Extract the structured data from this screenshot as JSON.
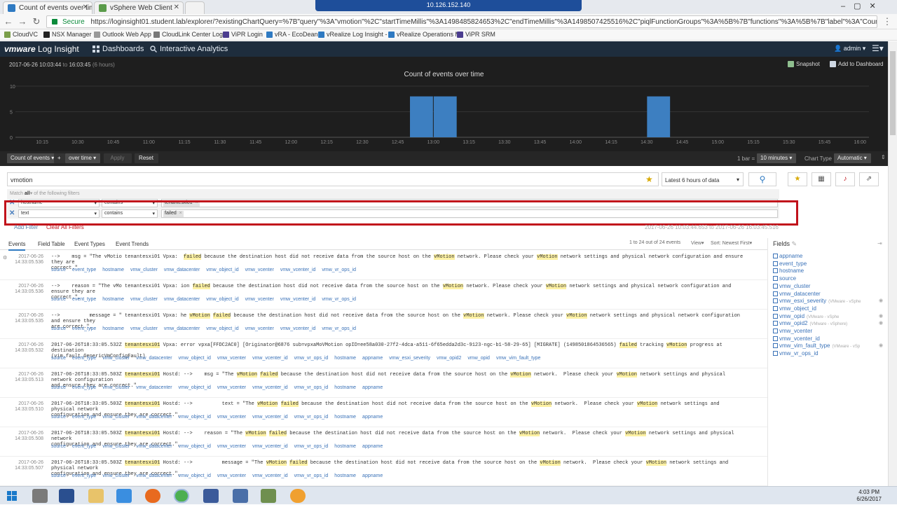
{
  "browser": {
    "tabs": [
      {
        "title": "Count of events over tim",
        "active": true
      },
      {
        "title": "vSphere Web Client",
        "active": false
      }
    ],
    "remote_title": "10.126.152.140",
    "secure_label": "Secure",
    "url": "https://loginsight01.student.lab/explorer/?existingChartQuery=%7B\"query\"%3A\"vmotion\"%2C\"startTimeMillis\"%3A1498485824653%2C\"endTimeMillis\"%3A1498507425516%2C\"piqlFunctionGroups\"%3A%5B%7B\"functions\"%3A%5B%7B\"label\"%3A\"Count\"%2C\"value\"%3A\"C",
    "bookmarks": [
      "CloudVC",
      "NSX Manager",
      "Outlook Web App",
      "CloudLink Center Log",
      "ViPR Login",
      "vRA - EcoDean",
      "vRealize Log Insight -",
      "vRealize Operations M",
      "ViPR SRM"
    ]
  },
  "app": {
    "logo_brand": "vmware",
    "logo_product": "Log Insight",
    "nav": [
      "Dashboards",
      "Interactive Analytics"
    ],
    "user": "admin"
  },
  "chart": {
    "time_start": "2017-06-26 10:03:44",
    "time_to": "to",
    "time_end": "16:03:45",
    "duration": "(6 hours)",
    "snapshot_label": "Snapshot",
    "add_dashboard_label": "Add to Dashboard"
  },
  "chart_data": {
    "type": "bar",
    "title": "Count of events over time",
    "x_ticks": [
      "10:15",
      "10:30",
      "10:45",
      "11:00",
      "11:15",
      "11:30",
      "11:45",
      "12:00",
      "12:15",
      "12:30",
      "12:45",
      "13:00",
      "13:15",
      "13:30",
      "13:45",
      "14:00",
      "14:15",
      "14:30",
      "14:45",
      "15:00",
      "15:15",
      "15:30",
      "15:45",
      "16:00"
    ],
    "y_ticks": [
      0,
      5,
      10
    ],
    "ylim": [
      0,
      10
    ],
    "bars": [
      {
        "start": "12:50",
        "end": "13:00",
        "value": 8
      },
      {
        "start": "13:00",
        "end": "13:10",
        "value": 8
      },
      {
        "start": "14:30",
        "end": "14:40",
        "value": 8
      }
    ],
    "grid": true
  },
  "controls": {
    "count_btn": "Count of events",
    "plus_btn": "+",
    "over_time_btn": "over time",
    "apply_btn": "Apply",
    "reset_btn": "Reset",
    "bar_label": "1 bar =",
    "bar_value": "10 minutes",
    "chart_type_label": "Chart Type",
    "chart_type_value": "Automatic"
  },
  "query": {
    "text": "vmotion",
    "range": "Latest 6 hours of data"
  },
  "filters": {
    "match_prefix": "Match",
    "match_value": "all",
    "match_suffix": "of the following filters",
    "rows": [
      {
        "field": "hostname",
        "op": "contains",
        "value": "tenantesxi01"
      },
      {
        "field": "text",
        "op": "contains",
        "value": "failed"
      }
    ],
    "add_filter": "Add Filter",
    "clear_filters": "Clear All Filters",
    "range_start": "2017-06-26 10:03:44.653",
    "range_to": "to",
    "range_end": "2017-06-26 16:03:45.516"
  },
  "events_tabs": [
    "Events",
    "Field Table",
    "Event Types",
    "Event Trends"
  ],
  "events_meta": {
    "count": "1 to 24 out of 24 events",
    "view": "View",
    "sort": "Sort: Newest First"
  },
  "events": [
    {
      "date": "2017-06-26",
      "time": "14:33:05.536",
      "text_parts": [
        "-->    msg = \"The vMotio tenantesxi01 Vpxa:  ",
        "failed",
        " because the destination host did not receive data from the source host on the ",
        "vMotion",
        " network. Please check your ",
        "vMotion",
        " network settings and physical network configuration and ensure they are\ncorrect.\""
      ],
      "fields": [
        "source",
        "event_type",
        "hostname",
        "vmw_cluster",
        "vmw_datacenter",
        "vmw_object_id",
        "vmw_vcenter",
        "vmw_vcenter_id",
        "vmw_vr_ops_id"
      ]
    },
    {
      "date": "2017-06-26",
      "time": "14:33:05.536",
      "text_parts": [
        "-->    reason = \"The vMo tenantesxi01 Vpxa: ion ",
        "failed",
        " because the destination host did not receive data from the source host on the ",
        "vMotion",
        " network. Please check your ",
        "vMotion",
        " network settings and physical network configuration and ensure they are\ncorrect.\","
      ],
      "fields": [
        "source",
        "event_type",
        "hostname",
        "vmw_cluster",
        "vmw_datacenter",
        "vmw_object_id",
        "vmw_vcenter",
        "vmw_vcenter_id",
        "vmw_vr_ops_id"
      ]
    },
    {
      "date": "2017-06-26",
      "time": "14:33:05.535",
      "text_parts": [
        "-->          message = \" tenantesxi01 Vpxa: he ",
        "vMotion",
        " ",
        "failed",
        " because the destination host did not receive data from the source host on the ",
        "vMotion",
        " network. Please check your ",
        "vMotion",
        " network settings and physical network configuration and ensure they\nare correct.\","
      ],
      "fields": [
        "source",
        "event_type",
        "hostname",
        "vmw_cluster",
        "vmw_datacenter",
        "vmw_object_id",
        "vmw_vcenter",
        "vmw_vcenter_id",
        "vmw_vr_ops_id"
      ]
    },
    {
      "date": "2017-06-26",
      "time": "14:33:05.532",
      "text_parts": [
        "2017-06-26T18:33:05.532Z ",
        "tenantesxi01",
        " Vpxa: error vpxa[FFDC2AC0] [Originator@6876 sub=vpxaMoVMotion opID=ee58a030-27f2-4dca-a511-6f65edda2d3c-9123-ngc-b1-58-29-65] [MIGRATE] (1498501864536565) ",
        "failed",
        " tracking ",
        "vMotion",
        " progress at destination\n(vim.fault.GenericVmConfigFault)"
      ],
      "fields": [
        "source",
        "event_type",
        "vmw_cluster",
        "vmw_datacenter",
        "vmw_object_id",
        "vmw_vcenter",
        "vmw_vcenter_id",
        "vmw_vr_ops_id",
        "hostname",
        "appname",
        "vmw_esxi_severity",
        "vmw_opid2",
        "vmw_opid",
        "vmw_vim_fault_type"
      ]
    },
    {
      "date": "2017-06-26",
      "time": "14:33:05.513",
      "text_parts": [
        "2017-06-26T18:33:05.503Z ",
        "tenantesxi01",
        " Hostd: -->    msg = \"The ",
        "vMotion",
        " ",
        "failed",
        " because the destination host did not receive data from the source host on the ",
        "vMotion",
        " network.  Please check your ",
        "vMotion",
        " network settings and physical network configuration\nand ensure they are correct.\""
      ],
      "fields": [
        "source",
        "event_type",
        "vmw_cluster",
        "vmw_datacenter",
        "vmw_object_id",
        "vmw_vcenter",
        "vmw_vcenter_id",
        "vmw_vr_ops_id",
        "hostname",
        "appname"
      ]
    },
    {
      "date": "2017-06-26",
      "time": "14:33:05.510",
      "text_parts": [
        "2017-06-26T18:33:05.503Z ",
        "tenantesxi01",
        " Hostd: -->          text = \"The ",
        "vMotion",
        " ",
        "failed",
        " because the destination host did not receive data from the source host on the ",
        "vMotion",
        " network.  Please check your ",
        "vMotion",
        " network settings and physical network\nconfiguration and ensure they are correct.\","
      ],
      "fields": [
        "source",
        "event_type",
        "vmw_cluster",
        "vmw_datacenter",
        "vmw_object_id",
        "vmw_vcenter",
        "vmw_vcenter_id",
        "vmw_vr_ops_id",
        "hostname",
        "appname"
      ]
    },
    {
      "date": "2017-06-26",
      "time": "14:33:05.508",
      "text_parts": [
        "2017-06-26T18:33:05.503Z ",
        "tenantesxi01",
        " Hostd: -->    reason = \"The ",
        "vMotion",
        " ",
        "failed",
        " because the destination host did not receive data from the source host on the ",
        "vMotion",
        " network.  Please check your ",
        "vMotion",
        " network settings and physical network\nconfiguration and ensure they are correct.\","
      ],
      "fields": [
        "source",
        "event_type",
        "vmw_cluster",
        "vmw_datacenter",
        "vmw_object_id",
        "vmw_vcenter",
        "vmw_vcenter_id",
        "vmw_vr_ops_id",
        "hostname",
        "appname"
      ]
    },
    {
      "date": "2017-06-26",
      "time": "14:33:05.507",
      "text_parts": [
        "2017-06-26T18:33:05.503Z ",
        "tenantesxi01",
        " Hostd: -->          message = \"The ",
        "vMotion",
        " ",
        "failed",
        " because the destination host did not receive data from the source host on the ",
        "vMotion",
        " network.  Please check your ",
        "vMotion",
        " network settings and physical network\nconfiguration and ensure they are correct.\","
      ],
      "fields": [
        "source",
        "event_type",
        "vmw_cluster",
        "vmw_datacenter",
        "vmw_object_id",
        "vmw_vcenter",
        "vmw_vcenter_id",
        "vmw_vr_ops_id",
        "hostname",
        "appname"
      ]
    }
  ],
  "fields_panel": {
    "title": "Fields",
    "items": [
      {
        "name": "appname",
        "tag": ""
      },
      {
        "name": "event_type",
        "tag": ""
      },
      {
        "name": "hostname",
        "tag": ""
      },
      {
        "name": "source",
        "tag": ""
      },
      {
        "name": "vmw_cluster",
        "tag": ""
      },
      {
        "name": "vmw_datacenter",
        "tag": ""
      },
      {
        "name": "vmw_esxi_severity",
        "tag": "(VMware - vSphe"
      },
      {
        "name": "vmw_object_id",
        "tag": ""
      },
      {
        "name": "vmw_opid",
        "tag": "(VMware - vSphe"
      },
      {
        "name": "vmw_opid2",
        "tag": "(VMware - vSphere)"
      },
      {
        "name": "vmw_vcenter",
        "tag": ""
      },
      {
        "name": "vmw_vcenter_id",
        "tag": ""
      },
      {
        "name": "vmw_vim_fault_type",
        "tag": "(VMware - vSp"
      },
      {
        "name": "vmw_vr_ops_id",
        "tag": ""
      }
    ]
  },
  "taskbar": {
    "clock_time": "4:03 PM",
    "clock_date": "6/26/2017"
  },
  "colors": {
    "bar": "#3d7fc1",
    "highlight": "#fdf1a3",
    "red_box": "#c1121b",
    "nav_bg": "#1e2d3d",
    "chart_bg": "#1e1e1e"
  }
}
